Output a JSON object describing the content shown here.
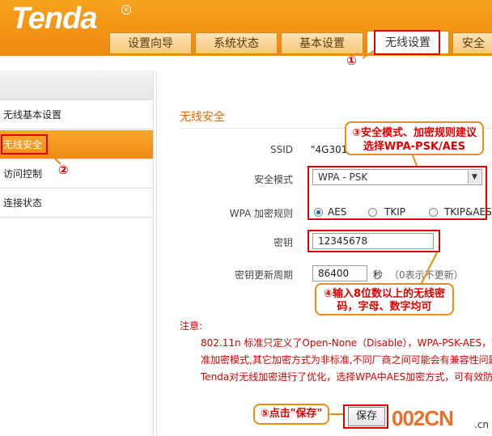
{
  "brand": {
    "logo": "Tenda",
    "reg_mark": "®"
  },
  "tabs": [
    {
      "label": "设置向导"
    },
    {
      "label": "系统状态"
    },
    {
      "label": "基本设置"
    },
    {
      "label": "无线设置",
      "active": true
    },
    {
      "label": "安全"
    }
  ],
  "sidebar": {
    "items": [
      {
        "label": "无线基本设置"
      },
      {
        "label": "无线安全",
        "active": true
      },
      {
        "label": "访问控制"
      },
      {
        "label": "连接状态"
      }
    ]
  },
  "form": {
    "title": "无线安全",
    "ssid_label": "SSID",
    "ssid_value": "\"4G301\"",
    "mode_label": "安全模式",
    "mode_value": "WPA - PSK",
    "cipher_label": "WPA 加密规则",
    "cipher_options": [
      "AES",
      "TKIP",
      "TKIP&AES"
    ],
    "cipher_selected": "AES",
    "key_label": "密钥",
    "key_value": "12345678",
    "renew_label": "密钥更新周期",
    "renew_value": "86400",
    "renew_unit": "秒",
    "renew_hint": "（0表示不更新）",
    "save_label": "保存"
  },
  "notes": {
    "title": "注意:",
    "lines": [
      "802.11n 标准只定义了Open-None（Disable），WPA-PSK-AES，W",
      "准加密模式,其它加密方式为非标准,不同厂商之间可能会有兼容性问题",
      "Tenda对无线加密进行了优化，选择WPA中AES加密方式，可有效防"
    ]
  },
  "annotations": {
    "step1": "①",
    "step2": "②",
    "step3_text": "③安全模式、加密规则建议选择WPA-PSK/AES",
    "step4_text": "④输入8位数以上的无线密码，字母、数字均可",
    "step5_text": "⑤点击\"保存\""
  },
  "watermark": {
    "text": "002CN",
    "suffix": ".cn"
  },
  "colors": {
    "accent": "#ef8a10",
    "annotation_red": "#e00000",
    "title_orange": "#e06a00"
  }
}
